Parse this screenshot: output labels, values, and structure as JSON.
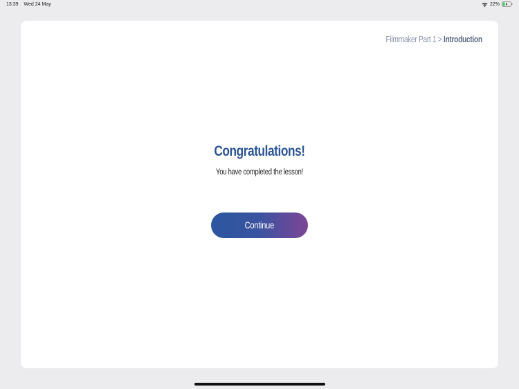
{
  "status_bar": {
    "time": "13:39",
    "date": "Wed 24 May",
    "battery_percent": "22%",
    "wifi_icon": "wifi-icon",
    "battery_icon": "battery-charging-icon"
  },
  "breadcrumb": {
    "parent": "Filmmaker Part 1",
    "separator": ">",
    "current": "Introduction"
  },
  "main": {
    "heading": "Congratulations!",
    "message": "You have completed the lesson!",
    "continue_label": "Continue"
  },
  "colors": {
    "heading": "#2c5592",
    "button_gradient_start": "#2c57a0",
    "button_gradient_end": "#7e4596",
    "background": "#ececee",
    "card": "#ffffff"
  }
}
